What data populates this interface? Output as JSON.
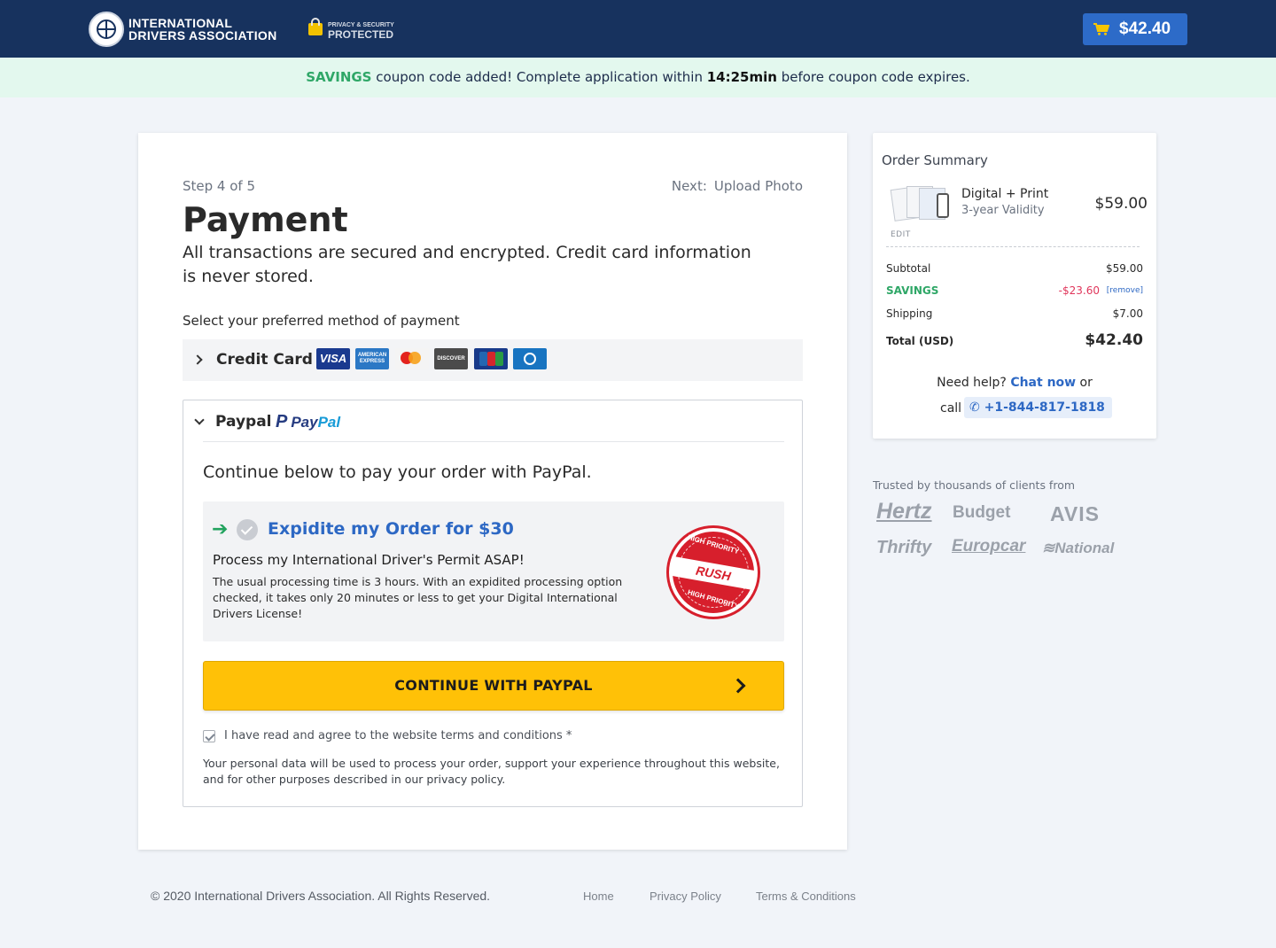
{
  "header": {
    "brand_line1": "INTERNATIONAL",
    "brand_line2": "DRIVERS ASSOCIATION",
    "badge_line1": "PRIVACY & SECURITY",
    "badge_line2": "PROTECTED",
    "cart_total": "$42.40",
    "cart_icon": "shopping-cart-icon",
    "logo_icon": "globe-icon",
    "colors": {
      "bar": "#17325e",
      "cart_button": "#2d6bc8"
    }
  },
  "banner": {
    "code": "SAVINGS",
    "text_before": " coupon code added! Complete application within ",
    "timer": "14:25min",
    "text_after": " before coupon code expires."
  },
  "main": {
    "step": "Step 4 of 5",
    "next_label": "Next:",
    "next_step": "Upload Photo",
    "title": "Payment",
    "subtitle": "All transactions are secured and encrypted. Credit card information is never stored.",
    "select_label": "Select your preferred method of payment",
    "credit_card": {
      "label": "Credit Card",
      "logos": [
        {
          "icon": "visa-icon",
          "text": "VISA"
        },
        {
          "icon": "amex-icon",
          "text": "AMERICAN EXPRESS"
        },
        {
          "icon": "mastercard-icon",
          "text": ""
        },
        {
          "icon": "discover-icon",
          "text": "DISCOVER"
        },
        {
          "icon": "jcb-icon",
          "text": ""
        },
        {
          "icon": "diners-club-icon",
          "text": ""
        }
      ]
    },
    "paypal": {
      "label": "Paypal",
      "logo_p": "P",
      "logo_a": "Pay",
      "logo_b": "Pal",
      "continue_text": "Continue below to pay your order with PayPal.",
      "expedite": {
        "title": "Expidite my Order for $30",
        "subtitle": "Process my International Driver's Permit ASAP!",
        "description": "The usual processing time is 3 hours. With an expidited processing option checked, it takes only 20 minutes or less to get your Digital International Drivers License!",
        "stamp_top": "HIGH PRIORITY",
        "stamp_main": "RUSH ORDER!",
        "stamp_bottom": "HIGH PRIORITY",
        "checked": true
      },
      "button_label": "CONTINUE WITH PAYPAL",
      "terms_text": "I have read and agree to the website terms and conditions *",
      "terms_checked": true,
      "privacy_text": "Your personal data will be used to process your order, support your experience throughout this website, and for other purposes described in our privacy policy."
    },
    "colors": {
      "accent": "#2d68c4",
      "savings": "#2fa767",
      "button": "#ffc107"
    }
  },
  "summary": {
    "title": "Order Summary",
    "product_name": "Digital + Print",
    "product_validity": "3-year Validity",
    "product_price": "$59.00",
    "edit_label": "EDIT",
    "subtotal_label": "Subtotal",
    "subtotal_value": "$59.00",
    "savings_label": "SAVINGS",
    "savings_value": "-$23.60",
    "remove_label": "[remove]",
    "shipping_label": "Shipping",
    "shipping_value": "$7.00",
    "total_label": "Total (USD)",
    "total_value": "$42.40",
    "help_text": "Need help?",
    "chat_label": "Chat now",
    "or_text": "or",
    "call_text": "call",
    "phone": "+1-844-817-1818",
    "phone_icon": "phone-icon"
  },
  "trusted": {
    "label": "Trusted by thousands of clients from",
    "brands": [
      "Hertz",
      "Budget",
      "AVIS",
      "Thrifty",
      "Europcar",
      "National"
    ]
  },
  "footer": {
    "copyright": "© 2020 International Drivers Association. All Rights Reserved.",
    "links": [
      "Home",
      "Privacy Policy",
      "Terms & Conditions"
    ]
  }
}
